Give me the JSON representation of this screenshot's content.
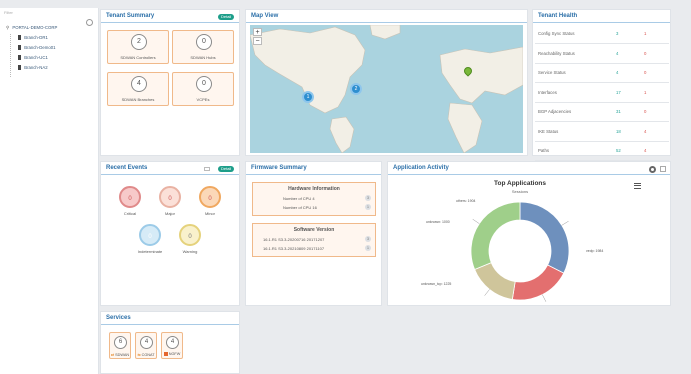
{
  "tree": {
    "search_placeholder": "Filter",
    "root": "PORTAL-DEMO-CORP",
    "children": [
      "Branch-DR1",
      "Branch-Demo01",
      "Branch-UC1",
      "Branch-NA2"
    ]
  },
  "tenant_summary": {
    "title": "Tenant Summary",
    "badge": "Detail",
    "tiles": [
      {
        "value": "2",
        "label": "SDWAN Controllers"
      },
      {
        "value": "0",
        "label": "SDWAN Hubs"
      },
      {
        "value": "4",
        "label": "SDWAN Branches"
      },
      {
        "value": "0",
        "label": "VCPEs"
      }
    ]
  },
  "map_view": {
    "title": "Map View",
    "zoom_in": "+",
    "zoom_out": "−",
    "markers": [
      {
        "value": "1",
        "color": "#2e8fd0"
      },
      {
        "value": "2",
        "color": "#2e8fd0"
      },
      {
        "value": "",
        "color": "#7ab83a"
      }
    ]
  },
  "tenant_health": {
    "title": "Tenant Health",
    "rows": [
      {
        "label": "Config Sync Status",
        "up": "3",
        "down": "1"
      },
      {
        "label": "Reachability Status",
        "up": "4",
        "down": "0"
      },
      {
        "label": "Service Status",
        "up": "4",
        "down": "0"
      },
      {
        "label": "Interfaces",
        "up": "17",
        "down": "1"
      },
      {
        "label": "BGP Adjacencies",
        "up": "31",
        "down": "0"
      },
      {
        "label": "IKE Status",
        "up": "18",
        "down": "4"
      },
      {
        "label": "Paths",
        "up": "52",
        "down": "4"
      }
    ]
  },
  "recent_events": {
    "title": "Recent Events",
    "badge": "Detail",
    "events": [
      {
        "value": "0",
        "label": "Critical",
        "color": "#f7c9c9",
        "border": "#e08a8a"
      },
      {
        "value": "0",
        "label": "Major",
        "color": "#fbe0d8",
        "border": "#e9b2a3"
      },
      {
        "value": "0",
        "label": "Minor",
        "color": "#fbd8b8",
        "border": "#f0a860"
      },
      {
        "value": "0",
        "label": "Indeterminate",
        "color": "#d6ebf7",
        "border": "#9ccbe8"
      },
      {
        "value": "0",
        "label": "Warning",
        "color": "#f9f1cc",
        "border": "#e5d27c"
      }
    ]
  },
  "firmware_summary": {
    "title": "Firmware Summary",
    "hardware": {
      "heading": "Hardware Information",
      "rows": [
        {
          "label": "Number of CPU 4",
          "count": "3"
        },
        {
          "label": "Number of CPU 16",
          "count": "1"
        }
      ]
    },
    "software": {
      "heading": "Software Version",
      "rows": [
        {
          "label": "16.1.R1 S3.3-20200716 20171207",
          "count": "3"
        },
        {
          "label": "16.1.R1 S3.3-20210809 20171107",
          "count": "1"
        }
      ]
    }
  },
  "application_activity": {
    "title": "Application Activity",
    "settings_icon": "gear-icon",
    "expand_icon": "expand-icon",
    "menu_icon": "hamburger-menu-icon"
  },
  "chart_data": {
    "type": "pie",
    "title": "Top Applications",
    "subtitle": "Sessions",
    "slices": [
      {
        "label": "vedp: 1984",
        "value": 1984,
        "color": "#6e90bd"
      },
      {
        "label": "unknown_tcp: 1225",
        "value": 1225,
        "color": "#e36f6f"
      },
      {
        "label": "unknown: 1000",
        "value": 1000,
        "color": "#cfc59b"
      },
      {
        "label": "others: 1904",
        "value": 1904,
        "color": "#9fcf8a"
      }
    ]
  },
  "services": {
    "title": "Services",
    "tiles": [
      {
        "value": "6",
        "label": "SDWAN"
      },
      {
        "value": "4",
        "label": "CGNAT"
      },
      {
        "value": "4",
        "label": "NGFW"
      }
    ]
  }
}
